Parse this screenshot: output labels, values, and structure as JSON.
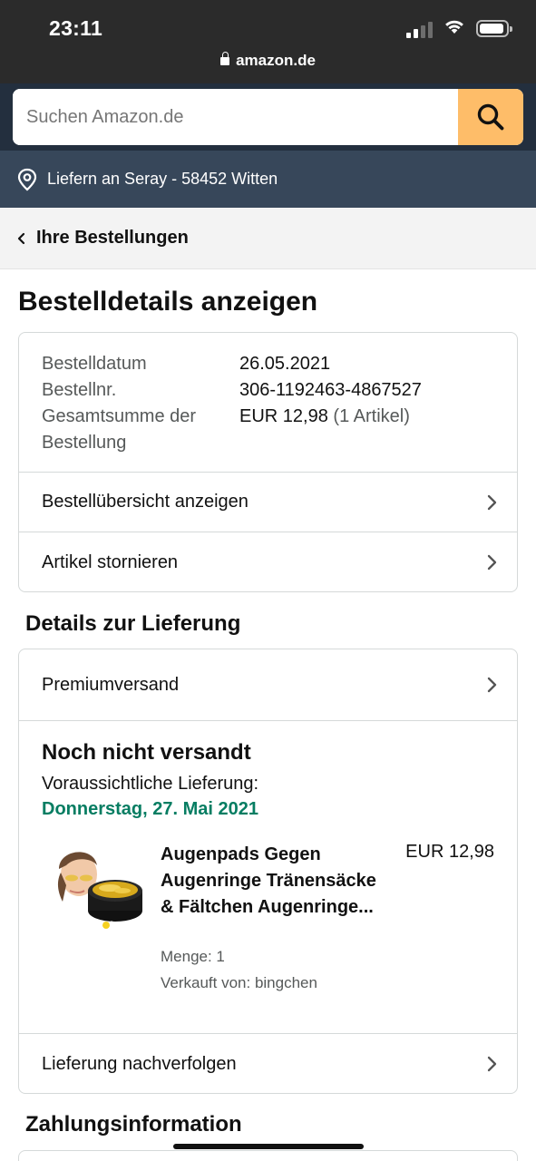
{
  "status": {
    "time": "23:11",
    "url": "amazon.de"
  },
  "search": {
    "placeholder": "Suchen Amazon.de",
    "button_icon": "search-icon",
    "button_color": "#febd69"
  },
  "delivery_location": {
    "text": "Liefern an Seray - 58452 Witten",
    "icon": "location-pin-icon"
  },
  "nav": {
    "back_label": "Ihre Bestellungen"
  },
  "page_title": "Bestelldetails anzeigen",
  "order_info": {
    "date_label": "Bestelldatum",
    "date_value": "26.05.2021",
    "number_label": "Bestellnr.",
    "number_value": "306-1192463-4867527",
    "total_label_1": "Gesamtsumme der",
    "total_label_2": "Bestellung",
    "total_value": "EUR 12,98",
    "total_items": "(1 Artikel)"
  },
  "order_actions": [
    {
      "label": "Bestellübersicht anzeigen"
    },
    {
      "label": "Artikel stornieren"
    }
  ],
  "delivery_section": {
    "title": "Details zur Lieferung",
    "shipping_method": "Premiumversand",
    "status": "Noch nicht versandt",
    "eta_label": "Voraussichtliche Lieferung:",
    "eta_date": "Donnerstag, 27. Mai 2021",
    "eta_color": "#067d62",
    "track_label": "Lieferung nachverfolgen"
  },
  "product": {
    "title": "Augenpads Gegen Augenringe Tränensäcke & Fältchen Augenringe...",
    "price": "EUR 12,98",
    "quantity": "Menge: 1",
    "seller": "Verkauft von: bingchen"
  },
  "payment_section": {
    "title": "Zahlungsinformation"
  }
}
